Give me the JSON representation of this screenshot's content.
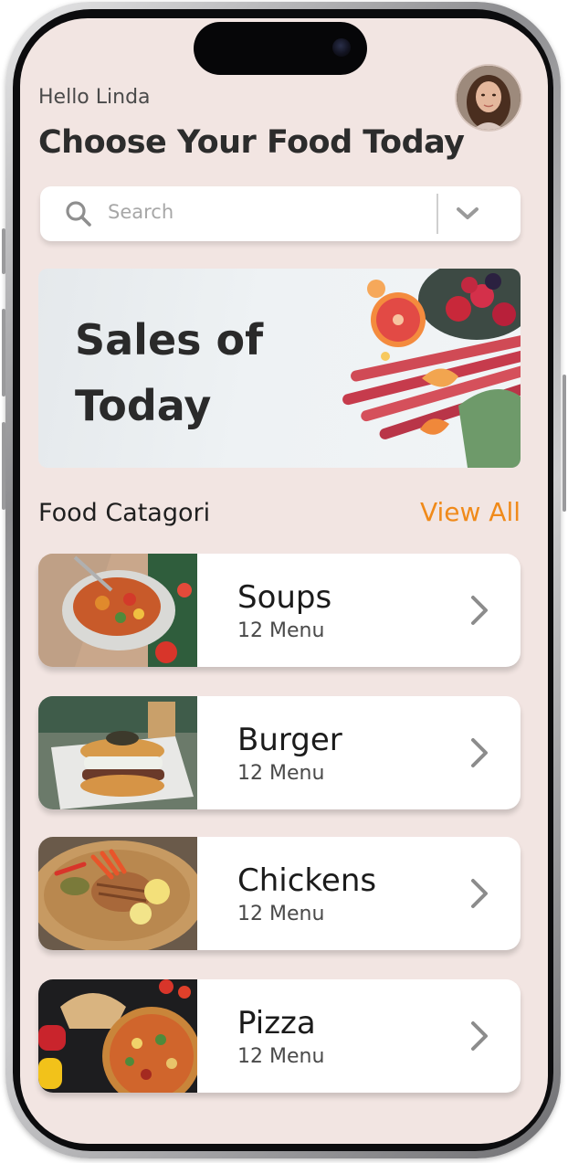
{
  "header": {
    "greeting": "Hello Linda",
    "title": "Choose Your Food Today"
  },
  "search": {
    "placeholder": "Search"
  },
  "banner": {
    "title": "Sales of\nToday"
  },
  "categories": {
    "title": "Food Catagori",
    "view_all": "View All",
    "items": [
      {
        "name": "Soups",
        "count": "12 Menu"
      },
      {
        "name": "Burger",
        "count": "12 Menu"
      },
      {
        "name": "Chickens",
        "count": "12 Menu"
      },
      {
        "name": "Pizza",
        "count": "12 Menu"
      }
    ]
  },
  "colors": {
    "background": "#f2e5e2",
    "accent": "#f08a1a",
    "card": "#ffffff",
    "text": "#2c2c2c"
  }
}
